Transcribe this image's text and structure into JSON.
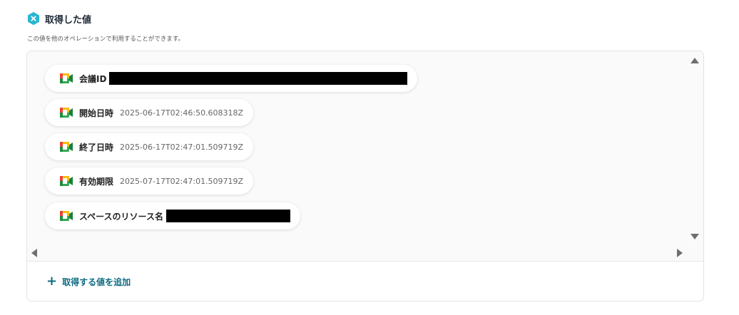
{
  "header": {
    "title": "取得した値",
    "subtitle": "この値を他のオペレーションで利用することができます。",
    "icon": "x-badge-icon",
    "icon_color": "#29b6d1"
  },
  "values": [
    {
      "label": "会議ID",
      "value": "",
      "redacted": true
    },
    {
      "label": "開始日時",
      "value": "2025-06-17T02:46:50.608318Z",
      "redacted": false
    },
    {
      "label": "終了日時",
      "value": "2025-06-17T02:47:01.509719Z",
      "redacted": false
    },
    {
      "label": "有効期限",
      "value": "2025-07-17T02:47:01.509719Z",
      "redacted": false
    },
    {
      "label": "スペースのリソース名",
      "value": "",
      "redacted": true
    }
  ],
  "add_button": {
    "label": "取得する値を追加",
    "icon": "plus-icon",
    "color": "#0e6b82"
  },
  "item_icon": "google-meet-icon"
}
